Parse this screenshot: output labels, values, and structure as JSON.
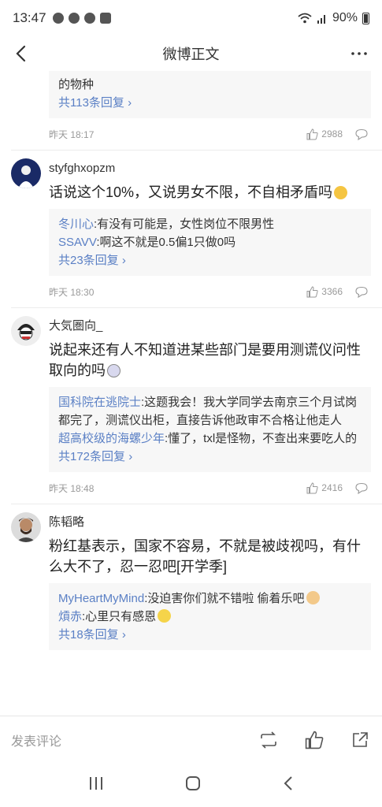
{
  "status_bar": {
    "time": "13:47",
    "battery": "90%"
  },
  "nav": {
    "title": "微博正文"
  },
  "partial_comment": {
    "text_tail": "的物种",
    "more": "共113条回复",
    "time": "昨天 18:17",
    "likes": "2988"
  },
  "comments": [
    {
      "username": "styfghxopzm",
      "text": "话说这个10%，又说男女不限，不自相矛盾吗",
      "replies": [
        {
          "name": "冬川心",
          "text": ":有没有可能是，女性岗位不限男性"
        },
        {
          "name": "SSAVV",
          "text": ":啊这不就是0.5偏1只做0吗"
        }
      ],
      "more": "共23条回复",
      "time": "昨天 18:30",
      "likes": "3366"
    },
    {
      "username": "大気圏向_",
      "text": "说起来还有人不知道进某些部门是要用测谎仪问性取向的吗",
      "replies": [
        {
          "name": "国科院在逃院士",
          "text": ":这题我会！我大学同学去南京三个月试岗都完了，测谎仪出柜，直接告诉他政审不合格让他走人"
        },
        {
          "name": "超高校级的海螺少年",
          "text": ":懂了，txl是怪物，不查出来要吃人的"
        }
      ],
      "more": "共172条回复",
      "time": "昨天 18:48",
      "likes": "2416"
    },
    {
      "username": "陈韬略",
      "text": "粉红基表示，国家不容易，不就是被歧视吗，有什么大不了，忍一忍吧[开学季]",
      "replies": [
        {
          "name": "MyHeartMyMind",
          "text": ":没迫害你们就不错啦 偷着乐吧"
        },
        {
          "name": "熕赤",
          "text": ":心里只有感恩"
        }
      ],
      "more": "共18条回复"
    }
  ],
  "bottom_bar": {
    "placeholder": "发表评论"
  },
  "colors": {
    "link": "#5b80c5",
    "reply_bg": "#f7f7f7"
  },
  "icons": [
    "back-arrow-icon",
    "more-dots-icon",
    "like-icon",
    "comment-icon",
    "repost-icon",
    "share-icon",
    "recent-apps-icon",
    "home-icon",
    "back-icon"
  ]
}
